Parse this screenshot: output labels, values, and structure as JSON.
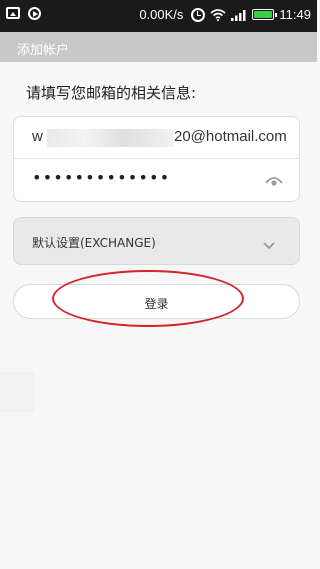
{
  "status_bar": {
    "net_speed": "0.00K/s",
    "time": "11:49",
    "icons": [
      "image-icon",
      "play-icon",
      "alarm-icon",
      "wifi-icon",
      "signal-icon",
      "battery-icon"
    ],
    "battery_color": "#36d044",
    "battery_level": 1.0
  },
  "title_bar": {
    "title": "添加帐户"
  },
  "form": {
    "prompt": "请填写您邮箱的相关信息:",
    "email_prefix": "w",
    "email_suffix": "20@hotmail.com",
    "password_mask": "•••••••••••••",
    "password_icon": "eye-icon",
    "account_type": "默认设置(EXCHANGE)",
    "account_type_icon": "chevron-down-icon",
    "login_label": "登录"
  },
  "colors": {
    "annotation": "#d4232a",
    "title_bar_bg": "#c8c8c8",
    "status_bar_bg": "#1a1a1a"
  }
}
